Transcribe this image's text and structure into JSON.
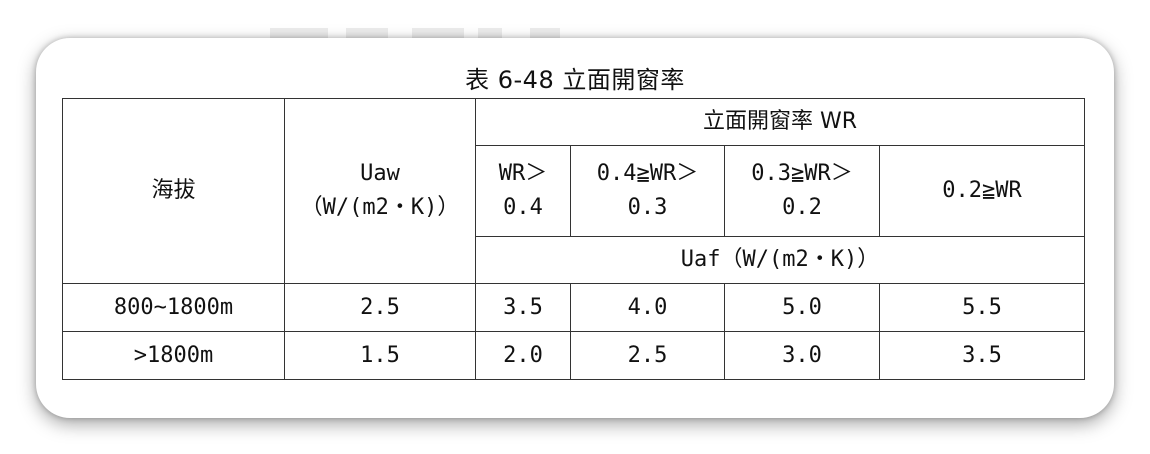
{
  "caption": "表 6-48 立面開窗率",
  "header": {
    "altitude": "海拔",
    "uaw_line1": "Uaw",
    "uaw_line2": "（W/(m2・K)）",
    "wr_group": "立面開窗率 WR",
    "wr_cols": [
      {
        "line1": "WR＞",
        "line2": "0.4"
      },
      {
        "line1": "0.4≧WR＞",
        "line2": "0.3"
      },
      {
        "line1": "0.3≧WR＞",
        "line2": "0.2"
      },
      {
        "line1": "0.2≧WR",
        "line2": ""
      }
    ],
    "uaf": "Uaf（W/(m2・K)）"
  },
  "rows": [
    {
      "altitude": "800~1800m",
      "uaw": "2.5",
      "uaf": [
        "3.5",
        "4.0",
        "5.0",
        "5.5"
      ]
    },
    {
      "altitude": ">1800m",
      "uaw": "1.5",
      "uaf": [
        "2.0",
        "2.5",
        "3.0",
        "3.5"
      ]
    }
  ]
}
